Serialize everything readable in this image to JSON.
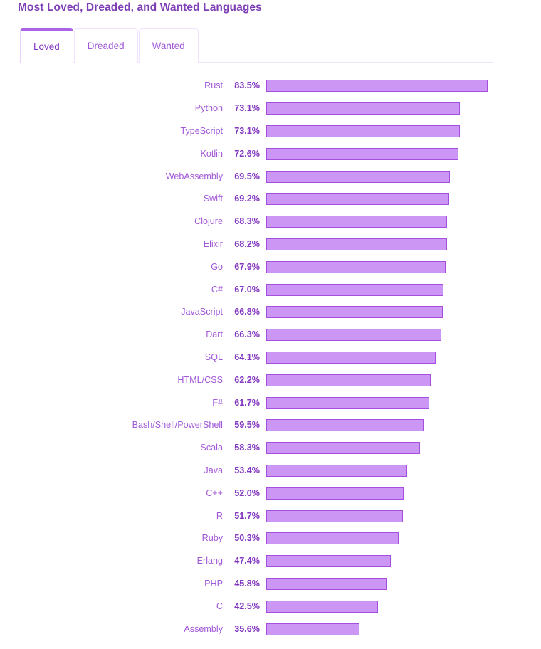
{
  "header": {
    "title": "Most Loved, Dreaded, and Wanted Languages"
  },
  "tabs": {
    "active": "Loved",
    "items": [
      {
        "label": "Loved",
        "active": true
      },
      {
        "label": "Dreaded",
        "active": false
      },
      {
        "label": "Wanted",
        "active": false
      }
    ]
  },
  "colors": {
    "title": "#7e3eb5",
    "tab_active_text": "#8437c4",
    "tab_inactive_text": "#a05ad6",
    "tab_active_top_border": "#ab63e8",
    "tab_border": "#f0e2fc",
    "label": "#a259d8",
    "value": "#8236c0",
    "bar_fill": "#cb96f4",
    "bar_border": "#a44fe0",
    "background": "#ffffff"
  },
  "chart_data": {
    "type": "bar",
    "orientation": "horizontal",
    "title": "Most Loved, Dreaded, and Wanted Languages",
    "subtitle": "",
    "xlabel": "",
    "ylabel": "",
    "grid": false,
    "legend": false,
    "value_suffix": "%",
    "xlim": [
      0,
      100
    ],
    "axis_visible": false,
    "categories": [
      "Rust",
      "Python",
      "TypeScript",
      "Kotlin",
      "WebAssembly",
      "Swift",
      "Clojure",
      "Elixir",
      "Go",
      "C#",
      "JavaScript",
      "Dart",
      "SQL",
      "HTML/CSS",
      "F#",
      "Bash/Shell/PowerShell",
      "Scala",
      "Java",
      "C++",
      "R",
      "Ruby",
      "Erlang",
      "PHP",
      "C",
      "Assembly"
    ],
    "values": [
      83.5,
      73.1,
      73.1,
      72.6,
      69.5,
      69.2,
      68.3,
      68.2,
      67.9,
      67.0,
      66.8,
      66.3,
      64.1,
      62.2,
      61.7,
      59.5,
      58.3,
      53.4,
      52.0,
      51.7,
      50.3,
      47.4,
      45.8,
      42.5,
      35.6
    ],
    "value_labels": [
      "83.5%",
      "73.1%",
      "73.1%",
      "72.6%",
      "69.5%",
      "69.2%",
      "68.3%",
      "68.2%",
      "67.9%",
      "67.0%",
      "66.8%",
      "66.3%",
      "64.1%",
      "62.2%",
      "61.7%",
      "59.5%",
      "58.3%",
      "53.4%",
      "52.0%",
      "51.7%",
      "50.3%",
      "47.4%",
      "45.8%",
      "42.5%",
      "35.6%"
    ]
  }
}
